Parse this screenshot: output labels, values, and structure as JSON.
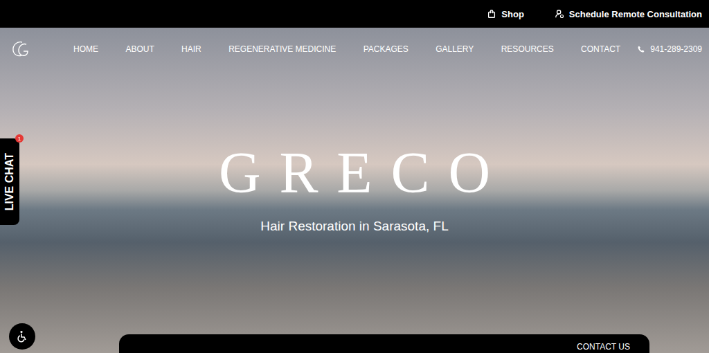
{
  "top_bar": {
    "links": [
      {
        "label": "Shop",
        "kind": "shop"
      },
      {
        "label": "Schedule Remote Consultation",
        "kind": "consult"
      }
    ]
  },
  "nav": {
    "items": [
      {
        "label": "HOME"
      },
      {
        "label": "ABOUT"
      },
      {
        "label": "HAIR"
      },
      {
        "label": "REGENERATIVE MEDICINE"
      },
      {
        "label": "PACKAGES"
      },
      {
        "label": "GALLERY"
      },
      {
        "label": "RESOURCES"
      },
      {
        "label": "CONTACT"
      }
    ],
    "phone": "941-289-2309"
  },
  "hero": {
    "logo_text": "GRECO",
    "subtitle": "Hair Restoration in Sarasota, FL"
  },
  "live_chat": {
    "label": "LIVE CHAT",
    "badge": "1"
  },
  "bottom_bar": {
    "button": "CONTACT US"
  }
}
